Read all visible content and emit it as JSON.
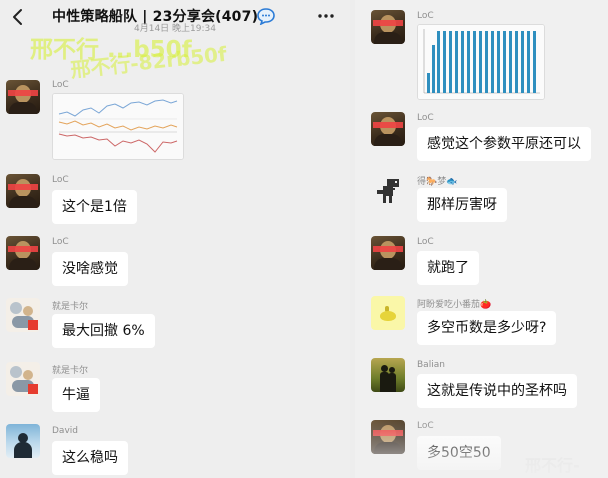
{
  "header": {
    "title": "中性策略船队 | 23分享会(407)",
    "timestamp": "4月14日 晚上19:34"
  },
  "watermarks": {
    "left_1": "邢不行 ...b50f",
    "left_2": "邢不行-82rb50f",
    "right": "邢不行-"
  },
  "left_messages": [
    {
      "sender": "LoC",
      "type": "image"
    },
    {
      "sender": "LoC",
      "text": "这个是1倍"
    },
    {
      "sender": "LoC",
      "text": "没啥感觉"
    },
    {
      "sender": "就是卡尔",
      "text": "最大回撤 6%"
    },
    {
      "sender": "就是卡尔",
      "text": "牛逼"
    },
    {
      "sender": "David",
      "text": "这么稳吗"
    }
  ],
  "right_messages": [
    {
      "sender": "LoC",
      "type": "image"
    },
    {
      "sender": "LoC",
      "text": "感觉这个参数平原还可以"
    },
    {
      "sender": "得🐎梦🐟",
      "text": "那样厉害呀"
    },
    {
      "sender": "LoC",
      "text": "就跑了"
    },
    {
      "sender": "阿盼爱吃小番茄🍅",
      "text": "多空币数是多少呀?"
    },
    {
      "sender": "Balian",
      "text": "这就是传说中的圣杯吗"
    },
    {
      "sender": "LoC",
      "text": "多50空50"
    }
  ],
  "icons": {
    "back": "chevron-left-icon",
    "chat": "chat-bubble-icon",
    "more": "more-dots-icon"
  },
  "colors": {
    "background": "#eeeeee",
    "bubble": "#ffffff",
    "watermark": "#d7f03c",
    "chart_bar": "#2f8fbf"
  }
}
